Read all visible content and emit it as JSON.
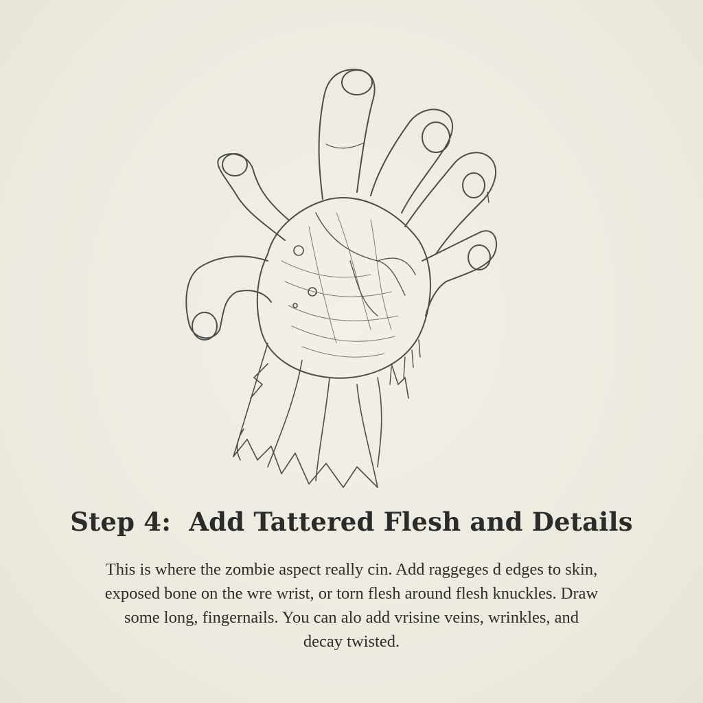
{
  "title": "Step 4:  Add Tattered Flesh and Details",
  "description_lines": [
    "This is where the zombie aspect really cin. Add raggeges d edges to skin,",
    "exposed bone on the wre wrist, or torn flesh around flesh knuckles. Draw",
    "some long, fingernails. You can alo add vrisine veins, wrinkles, and",
    "decay twisted."
  ],
  "illustration": {
    "icon": "zombie-hand-sketch-icon"
  },
  "colors": {
    "paper": "#efede3",
    "ink": "#2b2b29",
    "pencil": "#5a5a58"
  }
}
